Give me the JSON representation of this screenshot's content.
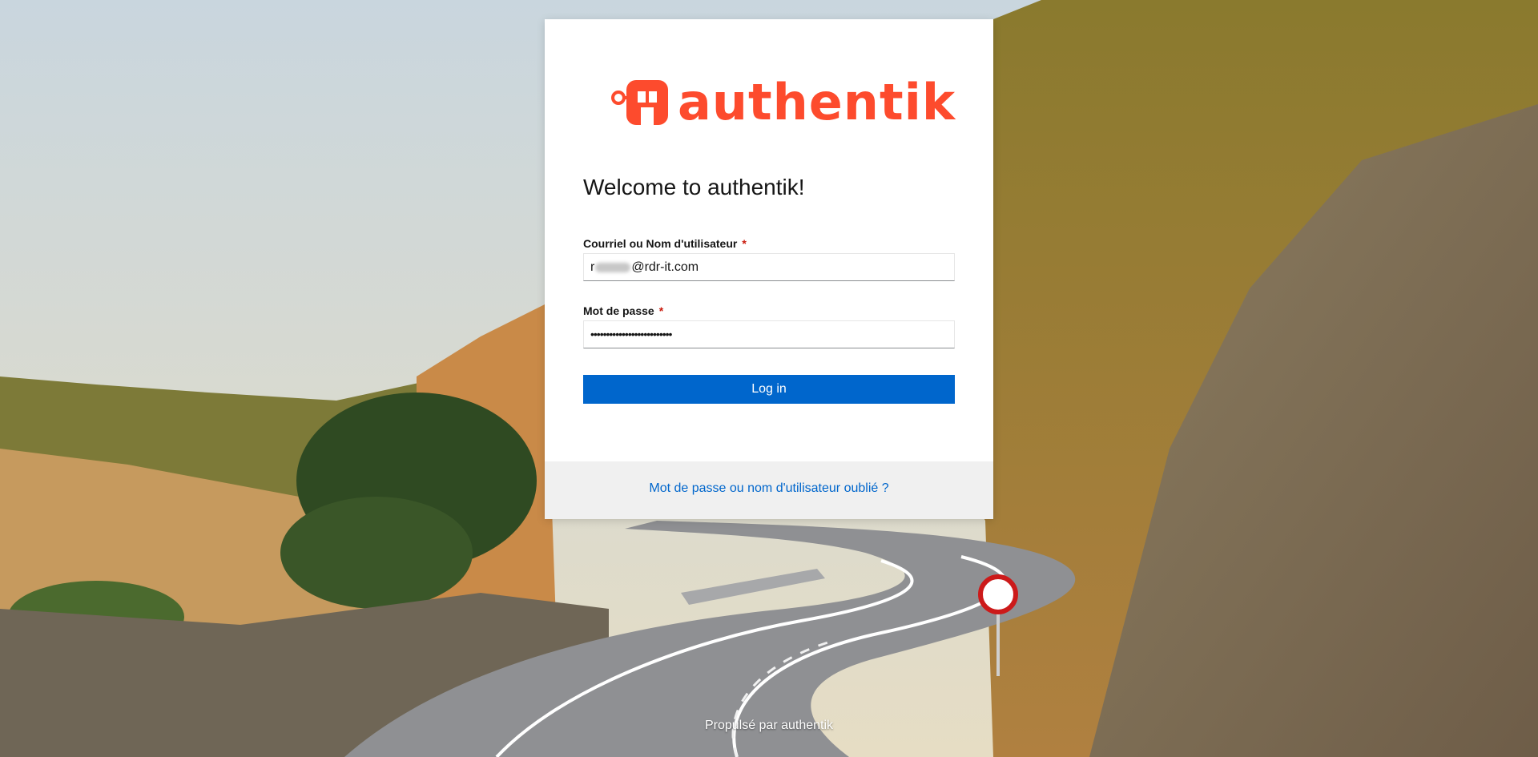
{
  "brand": {
    "name": "authentik",
    "color": "#fd4b2d"
  },
  "login": {
    "title": "Welcome to authentik!",
    "username_label": "Courriel ou Nom d'utilisateur",
    "username_value_prefix": "r",
    "username_value_suffix": "@rdr-it.com",
    "password_label": "Mot de passe",
    "password_value": "••••••••••••••••••••••••••",
    "required_mark": "*",
    "submit_label": "Log in",
    "forgot_link": "Mot de passe ou nom d'utilisateur oublié ?"
  },
  "footer": {
    "powered_by": "Propulsé par authentik"
  },
  "colors": {
    "primary": "#0066cc",
    "required": "#c9190b"
  }
}
